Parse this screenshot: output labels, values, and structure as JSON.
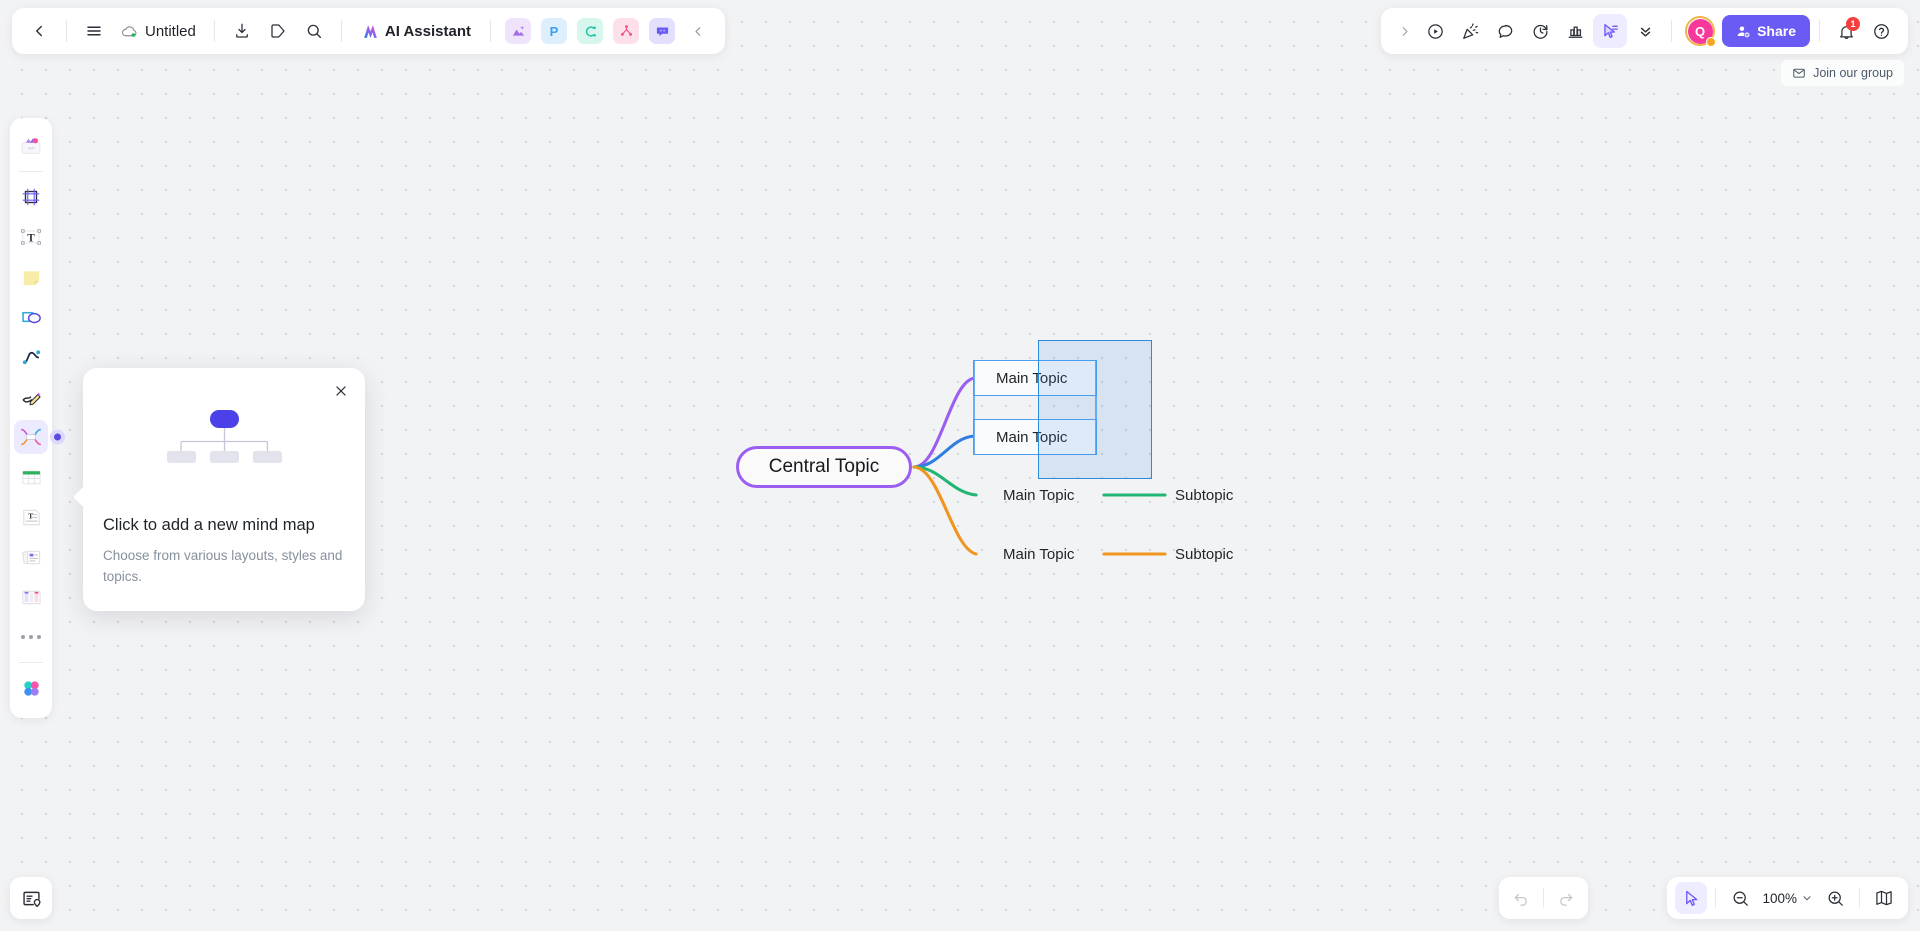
{
  "app": {
    "document_title": "Untitled",
    "ai_assistant_label": "AI Assistant"
  },
  "toolbar_left": {
    "back_icon": "chevron-left-icon",
    "menu_icon": "hamburger-menu-icon",
    "cloud_save_icon": "cloud-saved-icon",
    "export_icon": "download-export-icon",
    "tag_icon": "tag-icon",
    "search_icon": "search-icon",
    "ai_icon": "ai-assistant-icon",
    "app_icons": [
      {
        "name": "image-ai-app-icon",
        "glyph": "◢",
        "bg": "#efe4fb",
        "fg": "#a36ce8"
      },
      {
        "name": "presentation-app-icon",
        "glyph": "P",
        "bg": "#ddeefd",
        "fg": "#3d9ef0"
      },
      {
        "name": "flowchart-app-icon",
        "glyph": "C",
        "bg": "#d6f6ee",
        "fg": "#22c3a6"
      },
      {
        "name": "mindmap-app-icon",
        "glyph": "⑂",
        "bg": "#fde0ea",
        "fg": "#f2528c"
      },
      {
        "name": "comment-app-icon",
        "glyph": "■",
        "bg": "#e2e0fc",
        "fg": "#6b5bf5"
      }
    ],
    "collapse_icon": "chevron-left-collapse-icon"
  },
  "toolbar_right": {
    "expand_icon": "chevron-right-icon",
    "items": [
      {
        "name": "present-play-button",
        "icon": "play-circle-icon"
      },
      {
        "name": "celebrate-button",
        "icon": "party-popper-icon"
      },
      {
        "name": "comment-button",
        "icon": "speech-bubble-icon"
      },
      {
        "name": "history-button",
        "icon": "clock-history-icon"
      },
      {
        "name": "stats-button",
        "icon": "bar-chart-icon"
      },
      {
        "name": "cursor-mode-button",
        "icon": "cursor-select-icon",
        "active": true
      },
      {
        "name": "more-chevrons-button",
        "icon": "double-chevron-down-icon"
      }
    ],
    "avatar_initial": "Q",
    "share_label": "Share",
    "notification_count": "1",
    "notification_icon": "bell-icon",
    "help_icon": "question-circle-icon"
  },
  "join_group": {
    "label": "Join our group",
    "icon": "envelope-icon"
  },
  "sidebar": {
    "items": [
      {
        "name": "sidebar-item-templates",
        "icon": "templates-gallery-icon"
      },
      {
        "name": "sidebar-item-frame",
        "icon": "frame-icon"
      },
      {
        "name": "sidebar-item-text",
        "icon": "text-T-icon"
      },
      {
        "name": "sidebar-item-sticky-note",
        "icon": "sticky-note-icon"
      },
      {
        "name": "sidebar-item-shapes",
        "icon": "shapes-icon"
      },
      {
        "name": "sidebar-item-connector",
        "icon": "curve-connector-icon"
      },
      {
        "name": "sidebar-item-pen",
        "icon": "pen-draw-icon"
      },
      {
        "name": "sidebar-item-mindmap",
        "icon": "mindmap-icon",
        "active": true
      },
      {
        "name": "sidebar-item-table",
        "icon": "table-icon"
      },
      {
        "name": "sidebar-item-document",
        "icon": "document-text-icon"
      },
      {
        "name": "sidebar-item-cards",
        "icon": "cards-stack-icon"
      },
      {
        "name": "sidebar-item-kanban",
        "icon": "kanban-columns-icon"
      },
      {
        "name": "sidebar-item-more",
        "icon": "more-dots-icon"
      },
      {
        "name": "sidebar-item-apps",
        "icon": "apps-grid-icon"
      }
    ]
  },
  "bottom_left": {
    "name": "outline-panel-button",
    "icon": "outline-location-icon"
  },
  "bottom_right": {
    "undo_icon": "undo-arrow-icon",
    "redo_icon": "redo-arrow-icon",
    "cursor_icon": "cursor-select-icon",
    "zoom_out_icon": "zoom-out-icon",
    "zoom_in_icon": "zoom-in-icon",
    "zoom_level": "100%",
    "chevron_icon": "chevron-down-icon",
    "minimap_icon": "minimap-book-icon"
  },
  "popup": {
    "title": "Click to add a new mind map",
    "description": "Choose from various layouts, styles and topics.",
    "close_icon": "close-x-icon",
    "illustration": "mindmap-tree-illustration"
  },
  "mindmap": {
    "central": {
      "label": "Central Topic",
      "border_color": "#9b5ef0"
    },
    "branches": [
      {
        "label": "Main Topic",
        "color": "#9b5ef0",
        "selected": true,
        "subtopic": null
      },
      {
        "label": "Main Topic",
        "color": "#2f7de1",
        "selected": true,
        "subtopic": null
      },
      {
        "label": "Main Topic",
        "color": "#22b573",
        "selected": false,
        "subtopic": "Subtopic"
      },
      {
        "label": "Main Topic",
        "color": "#f0951e",
        "selected": false,
        "subtopic": "Subtopic"
      }
    ],
    "selection_rect": {
      "fill": "#408ce6",
      "stroke": "#2e8ae0"
    }
  }
}
